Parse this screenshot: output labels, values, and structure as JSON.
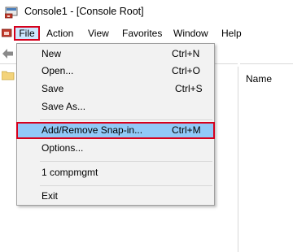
{
  "window": {
    "title": "Console1 - [Console Root]"
  },
  "menubar": {
    "items": [
      "File",
      "Action",
      "View",
      "Favorites",
      "Window",
      "Help"
    ]
  },
  "list": {
    "column_header": "Name"
  },
  "file_menu": {
    "new": {
      "label": "New",
      "shortcut": "Ctrl+N"
    },
    "open": {
      "label": "Open...",
      "shortcut": "Ctrl+O"
    },
    "save": {
      "label": "Save",
      "shortcut": "Ctrl+S"
    },
    "save_as": {
      "label": "Save As..."
    },
    "add_remove": {
      "label": "Add/Remove Snap-in...",
      "shortcut": "Ctrl+M"
    },
    "options": {
      "label": "Options..."
    },
    "recent": {
      "label": "1 compmgmt"
    },
    "exit": {
      "label": "Exit"
    }
  },
  "colors": {
    "highlight": "#91c9f7",
    "callout": "#d6001c",
    "menu_bg": "#f2f2f2"
  }
}
